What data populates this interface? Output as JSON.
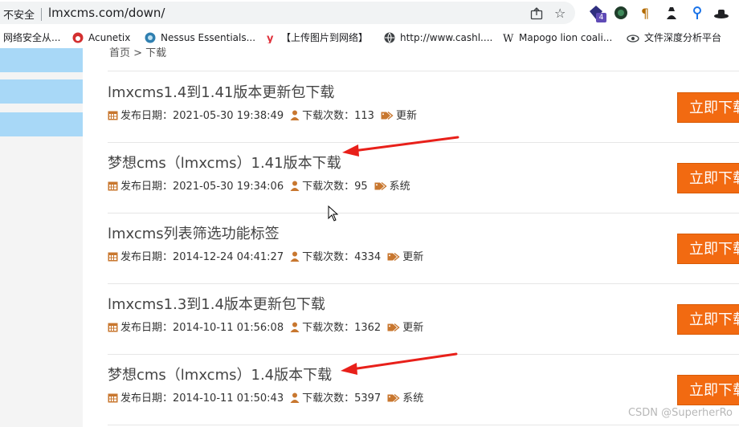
{
  "browser": {
    "security_label": "不安全",
    "url": "lmxcms.com/down/",
    "extension_badge": "4",
    "bookmarks": [
      {
        "label": "网络安全从...",
        "icon": "none"
      },
      {
        "label": "Acunetix",
        "icon": "acunetix-icon"
      },
      {
        "label": "Nessus Essentials...",
        "icon": "nessus-icon"
      },
      {
        "label": "【上传图片到网络】",
        "icon": "y-icon"
      },
      {
        "label": "http://www.cashl....",
        "icon": "globe-icon"
      },
      {
        "label": "Mapogo lion coali...",
        "icon": "wikipedia-icon"
      },
      {
        "label": "文件深度分析平台",
        "icon": "eye-icon"
      }
    ]
  },
  "page": {
    "breadcrumb": "首页 > 下载",
    "download_label": "立即下载",
    "items": [
      {
        "title": "lmxcms1.4到1.41版本更新包下载",
        "date_label": "发布日期：",
        "date": "2021-05-30 19:38:49",
        "count_label": "下载次数：",
        "count": "113",
        "tag": "更新"
      },
      {
        "title": "梦想cms（lmxcms）1.41版本下载",
        "date_label": "发布日期：",
        "date": "2021-05-30 19:34:06",
        "count_label": "下载次数：",
        "count": "95",
        "tag": "系统"
      },
      {
        "title": "lmxcms列表筛选功能标签",
        "date_label": "发布日期：",
        "date": "2014-12-24 04:41:27",
        "count_label": "下载次数：",
        "count": "4334",
        "tag": "更新"
      },
      {
        "title": "lmxcms1.3到1.4版本更新包下载",
        "date_label": "发布日期：",
        "date": "2014-10-11 01:56:08",
        "count_label": "下载次数：",
        "count": "1362",
        "tag": "更新"
      },
      {
        "title": "梦想cms（lmxcms）1.4版本下载",
        "date_label": "发布日期：",
        "date": "2014-10-11 01:50:43",
        "count_label": "下载次数：",
        "count": "5397",
        "tag": "系统"
      }
    ]
  },
  "colors": {
    "accent_orange": "#f26a11",
    "arrow_red": "#e8201a",
    "sidebar_blue": "#a8d8f7"
  },
  "watermark": "CSDN @SuperherRo"
}
